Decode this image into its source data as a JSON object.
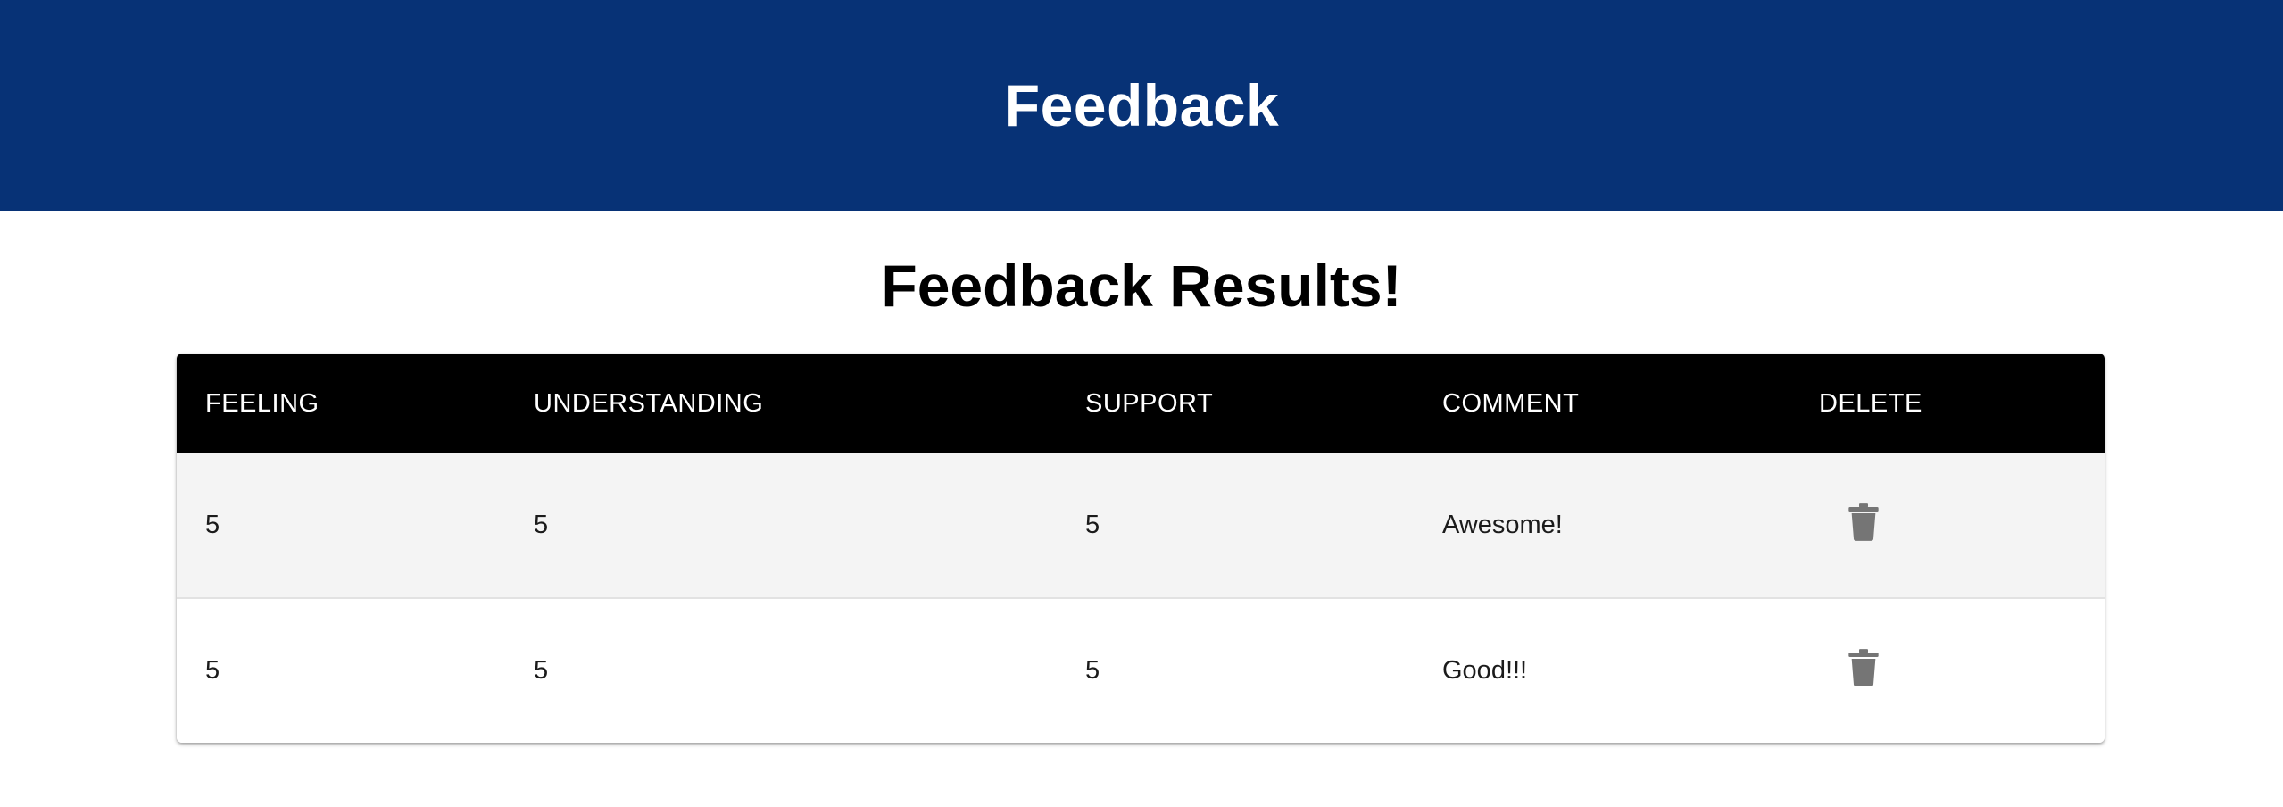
{
  "header": {
    "title": "Feedback"
  },
  "main": {
    "title": "Feedback Results!"
  },
  "table": {
    "columns": {
      "feeling": "FEELING",
      "understanding": "UNDERSTANDING",
      "support": "SUPPORT",
      "comment": "COMMENT",
      "delete": "DELETE"
    },
    "rows": [
      {
        "feeling": "5",
        "understanding": "5",
        "support": "5",
        "comment": "Awesome!",
        "delete_icon": "trash-icon"
      },
      {
        "feeling": "5",
        "understanding": "5",
        "support": "5",
        "comment": "Good!!!",
        "delete_icon": "trash-icon"
      }
    ]
  },
  "colors": {
    "header_bg": "#073276",
    "table_header_bg": "#000000",
    "row_shaded_bg": "#f4f4f4",
    "icon_gray": "#757575"
  }
}
